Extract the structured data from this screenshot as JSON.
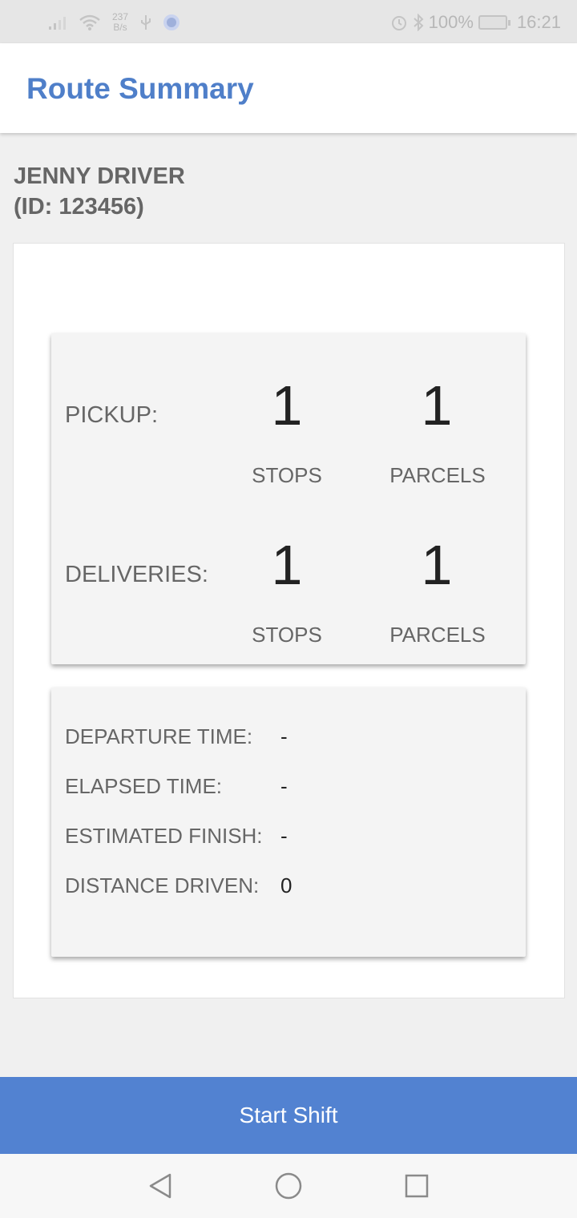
{
  "status_bar": {
    "net_speed_value": "237",
    "net_speed_unit": "B/s",
    "battery": "100%",
    "time": "16:21"
  },
  "app_bar": {
    "title": "Route Summary"
  },
  "driver": {
    "name": "JENNY DRIVER",
    "id_text": "(ID: 123456)"
  },
  "counts": {
    "pickup": {
      "label": "PICKUP:",
      "stops": "1",
      "parcels": "1",
      "stops_label": "STOPS",
      "parcels_label": "PARCELS"
    },
    "deliveries": {
      "label": "DELIVERIES:",
      "stops": "1",
      "parcels": "1",
      "stops_label": "STOPS",
      "parcels_label": "PARCELS"
    }
  },
  "times": [
    {
      "label": "DEPARTURE TIME:",
      "value": "-"
    },
    {
      "label": "ELAPSED TIME:",
      "value": "-"
    },
    {
      "label": "ESTIMATED FINISH:",
      "value": "-"
    },
    {
      "label": "DISTANCE DRIVEN:",
      "value": "0"
    }
  ],
  "actions": {
    "start_shift": "Start Shift"
  },
  "colors": {
    "accent": "#4f7fc9",
    "button": "#5282d1",
    "text_gray": "#666666",
    "text_dark": "#222222"
  },
  "icons": {
    "signal": "signal-icon",
    "wifi": "wifi-icon",
    "usb": "usb-icon",
    "app_notification": "notification-dot-icon",
    "alarm": "alarm-icon",
    "bluetooth": "bluetooth-icon",
    "battery": "battery-icon",
    "nav_back": "back-triangle-icon",
    "nav_home": "home-circle-icon",
    "nav_recents": "recents-square-icon"
  }
}
